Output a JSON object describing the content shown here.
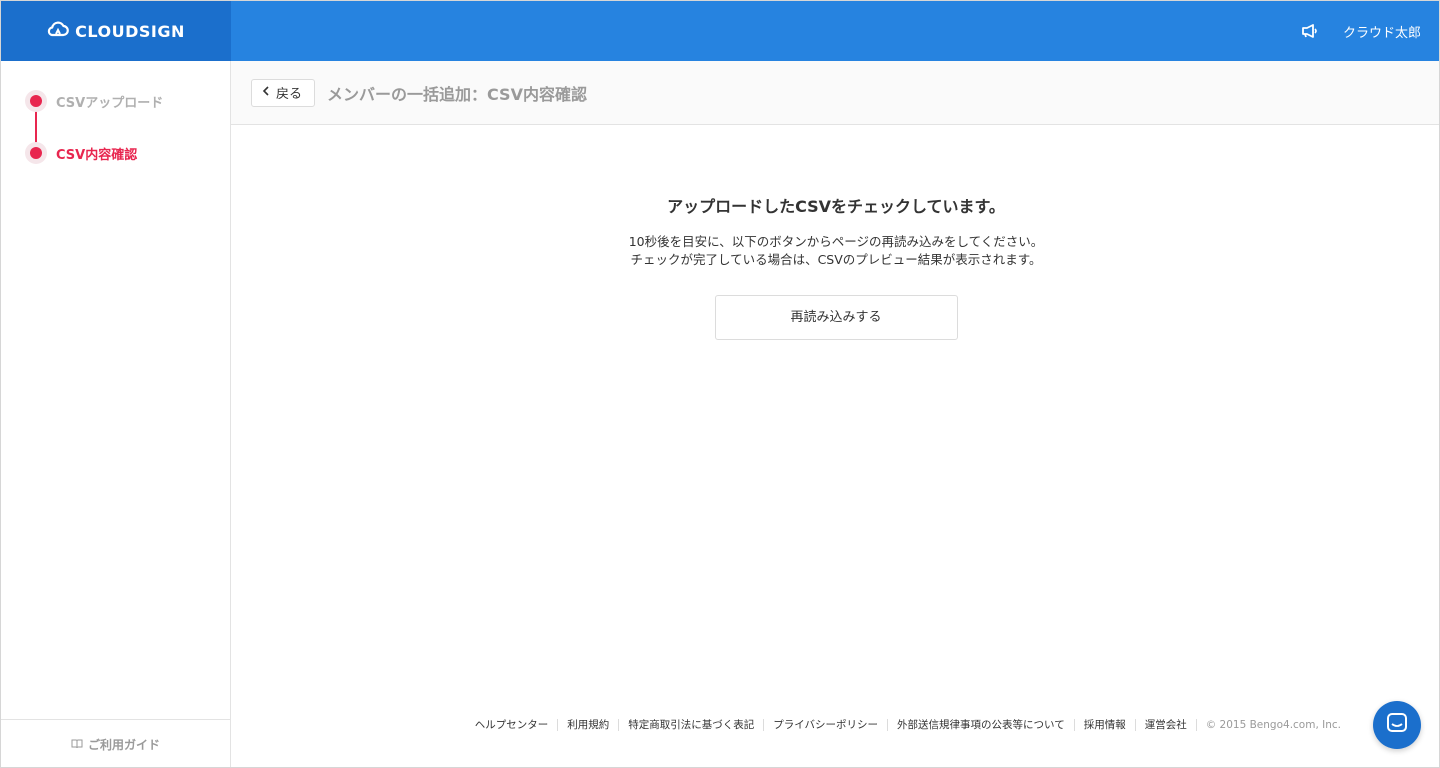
{
  "header": {
    "logo_text": "CLOUDSIGN",
    "user_name": "クラウド太郎",
    "announcement_icon": "megaphone-icon"
  },
  "sidebar": {
    "steps": [
      {
        "label": "CSVアップロード",
        "state": "done"
      },
      {
        "label": "CSV内容確認",
        "state": "active"
      }
    ],
    "guide_label": "ご利用ガイド"
  },
  "page": {
    "back_label": "戻る",
    "title": "メンバーの一括追加：CSV内容確認"
  },
  "content": {
    "title": "アップロードしたCSVをチェックしています。",
    "desc_line1": "10秒後を目安に、以下のボタンからページの再読み込みをしてください。",
    "desc_line2": "チェックが完了している場合は、CSVのプレビュー結果が表示されます。",
    "reload_label": "再読み込みする"
  },
  "footer": {
    "links": [
      "ヘルプセンター",
      "利用規約",
      "特定商取引法に基づく表記",
      "プライバシーポリシー",
      "外部送信規律事項の公表等について",
      "採用情報",
      "運営会社"
    ],
    "copyright": "© 2015 Bengo4.com, Inc."
  },
  "colors": {
    "header_blue": "#2683e0",
    "logo_blue": "#1b6fcc",
    "accent_red": "#e8264f"
  }
}
